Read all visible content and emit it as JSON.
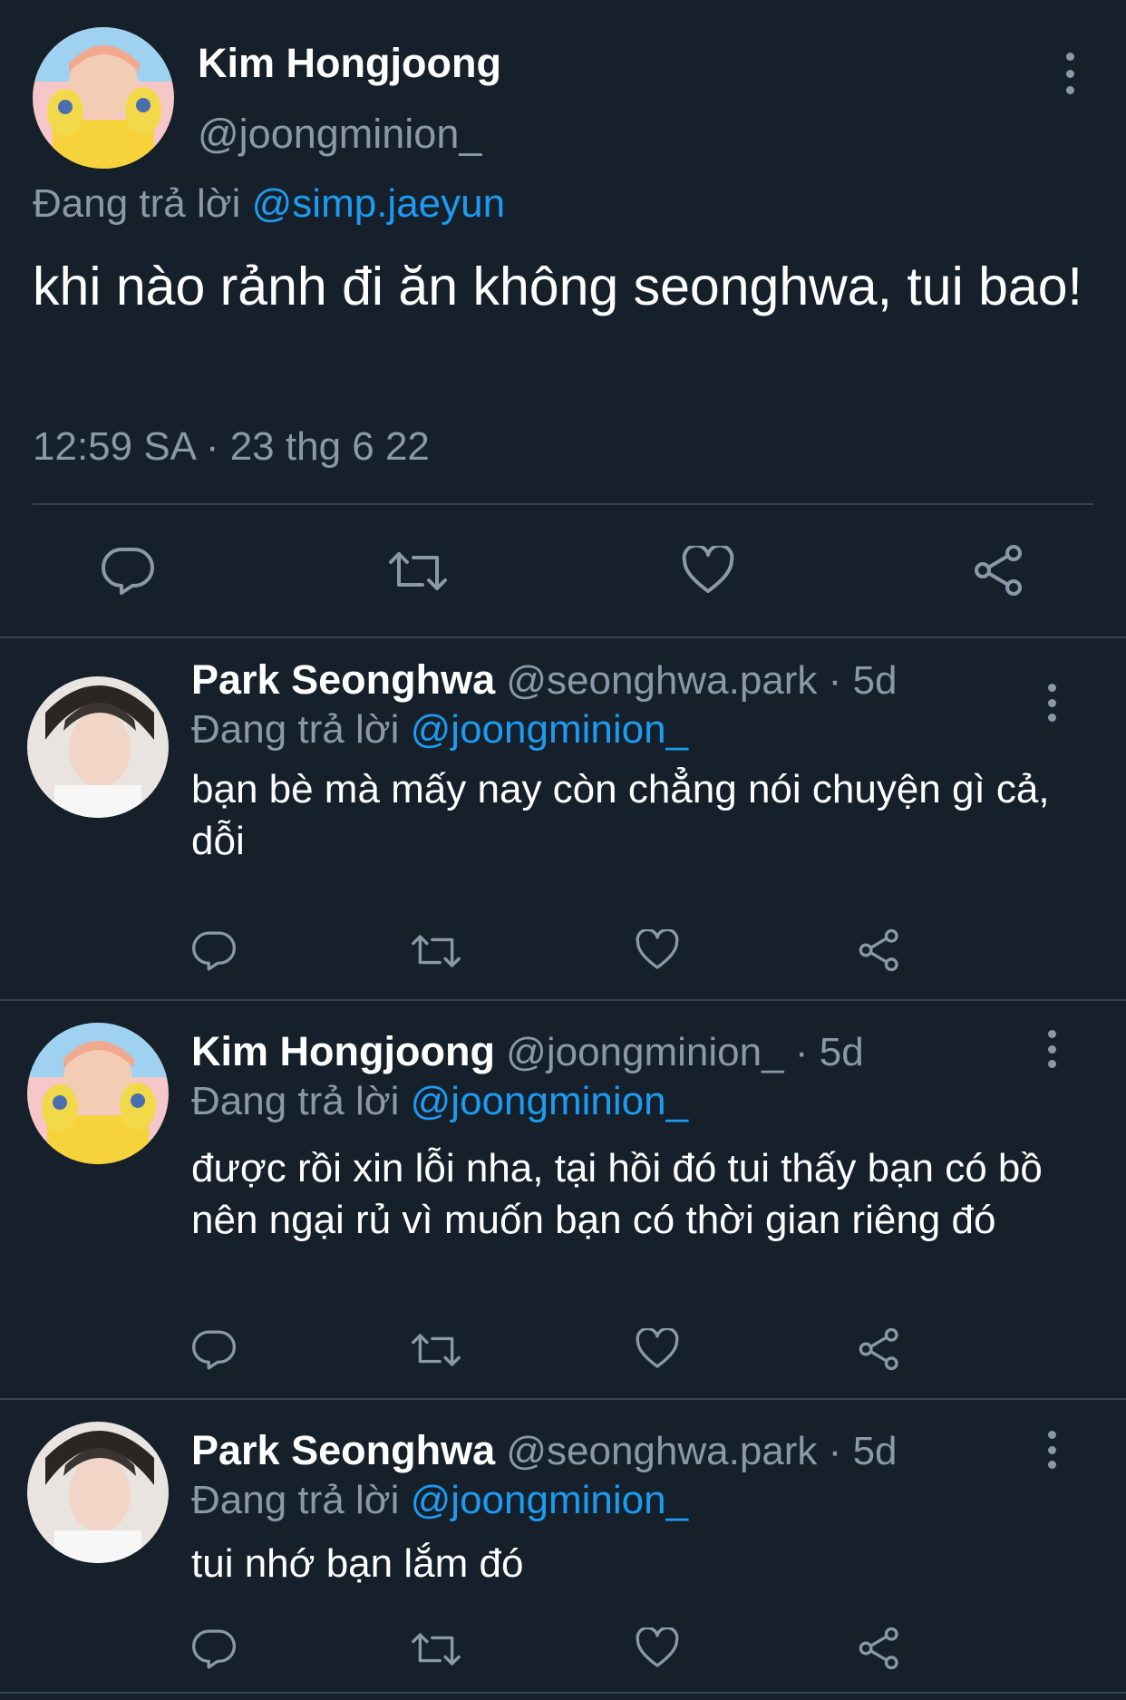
{
  "main_tweet": {
    "name": "Kim Hongjoong",
    "handle": "@joongminion_",
    "replying_prefix": "Đang trả lời",
    "replying_to": "@simp.jaeyun",
    "text": "khi nào rảnh đi ăn không seonghwa, tui bao!",
    "timestamp": "12:59 SA · 23 thg 6 22"
  },
  "replies": [
    {
      "name": "Park Seonghwa",
      "handle": "@seonghwa.park",
      "age": "5d",
      "replying_prefix": "Đang trả lời",
      "replying_to": "@joongminion_",
      "text": "bạn bè mà mấy nay còn chẳng nói chuyện gì cả, dỗi"
    },
    {
      "name": "Kim Hongjoong",
      "handle": "@joongminion_",
      "age": "5d",
      "replying_prefix": "Đang trả lời",
      "replying_to": "@joongminion_",
      "text": "được rồi xin lỗi nha, tại hồi đó tui thấy bạn có bồ nên ngại rủ vì muốn bạn có thời gian riêng đó"
    },
    {
      "name": "Park Seonghwa",
      "handle": "@seonghwa.park",
      "age": "5d",
      "replying_prefix": "Đang trả lời",
      "replying_to": "@joongminion_",
      "text": "tui nhớ bạn lắm đó"
    }
  ],
  "separator": "·",
  "icons": {
    "reply": "speech-bubble-icon",
    "retweet": "retweet-icon",
    "like": "heart-icon",
    "share": "share-icon",
    "more": "more-vertical-icon"
  },
  "colors": {
    "background": "#15202b",
    "text": "#ffffff",
    "secondary": "#8b98a5",
    "link": "#1d9bf0",
    "divider": "#38444d"
  }
}
